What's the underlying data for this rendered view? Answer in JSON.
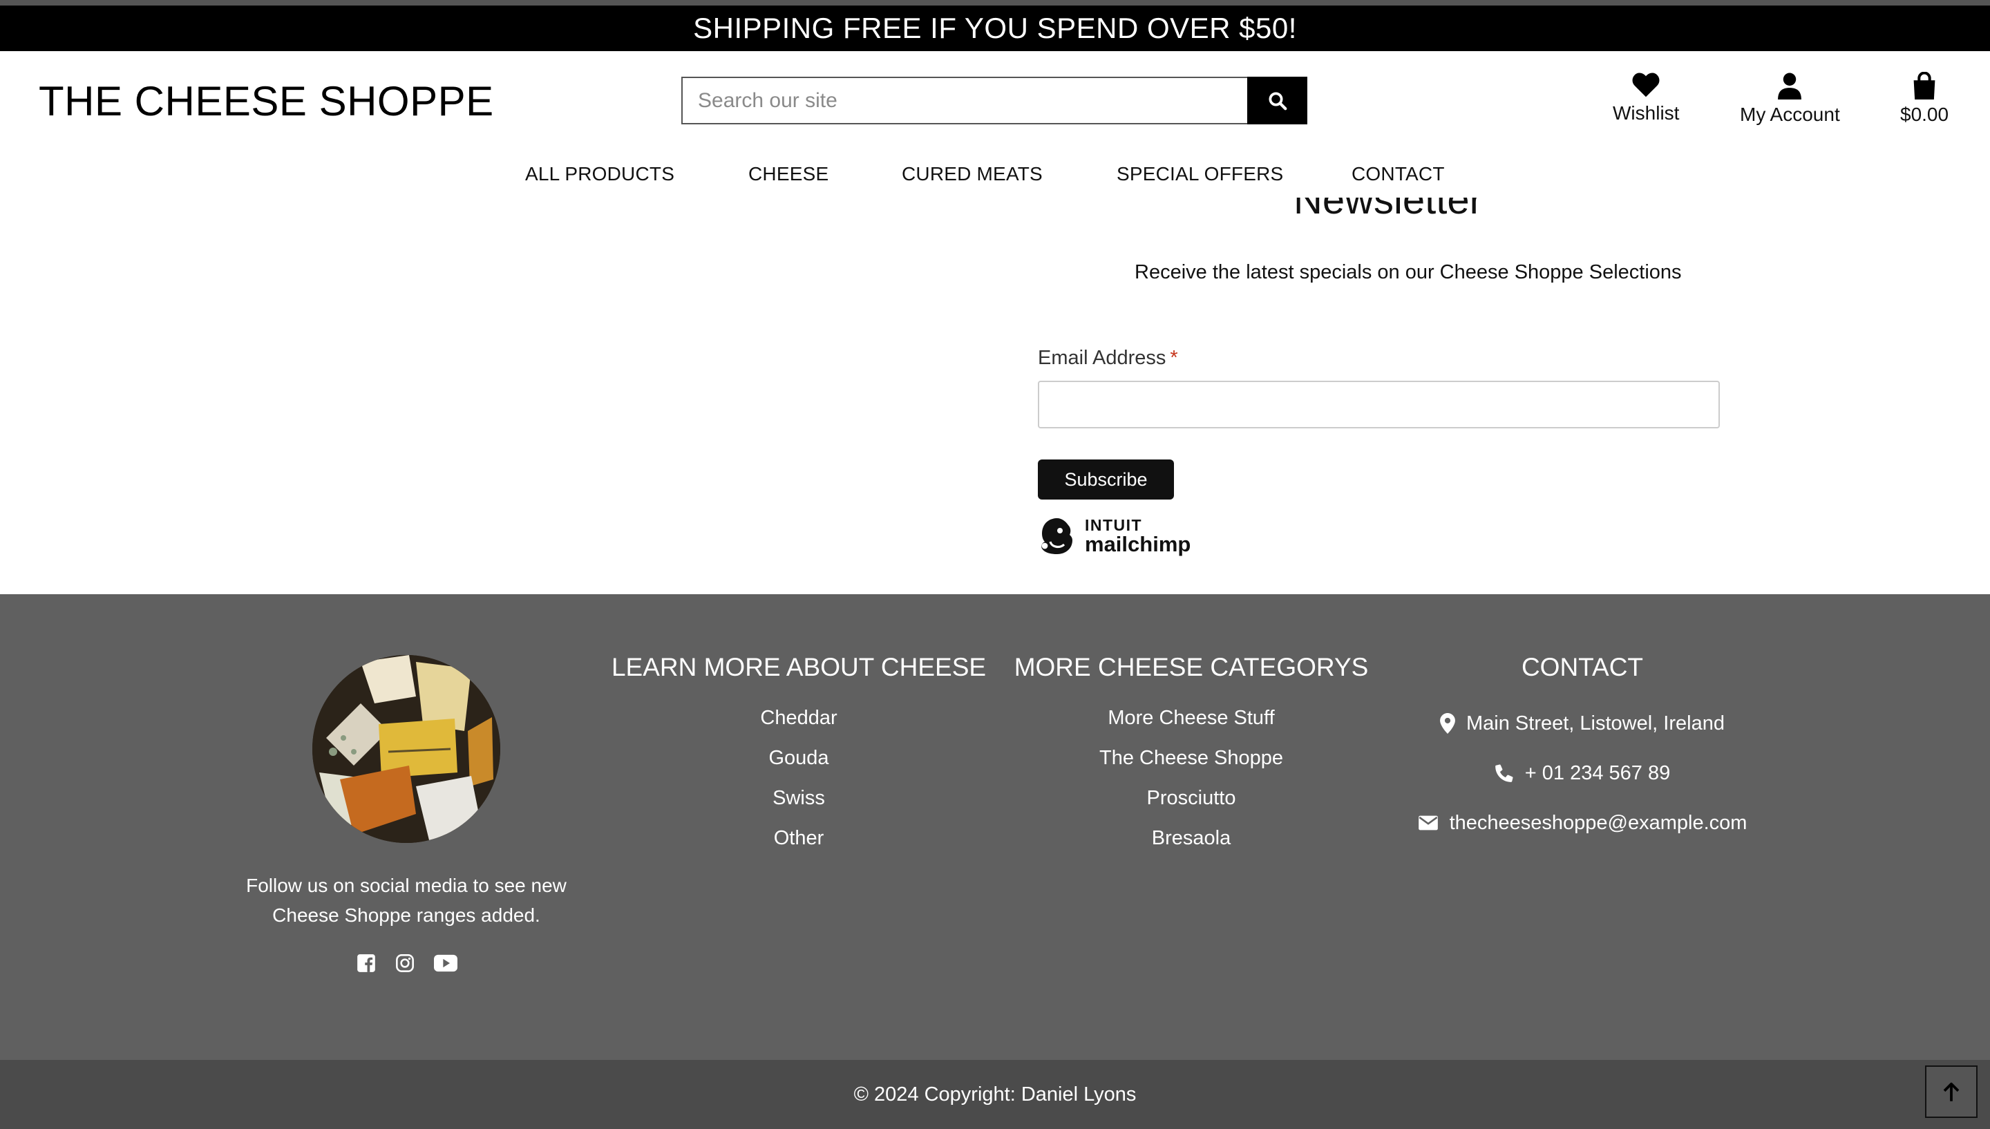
{
  "banner": {
    "text": "SHIPPING FREE IF YOU SPEND OVER $50!"
  },
  "header": {
    "logo": "THE CHEESE SHOPPE",
    "search": {
      "placeholder": "Search our site",
      "value": ""
    },
    "wishlist_label": "Wishlist",
    "account_label": "My Account",
    "cart_total": "$0.00"
  },
  "nav": {
    "items": [
      {
        "label": "ALL PRODUCTS"
      },
      {
        "label": "CHEESE"
      },
      {
        "label": "CURED MEATS"
      },
      {
        "label": "SPECIAL OFFERS"
      },
      {
        "label": "CONTACT"
      }
    ]
  },
  "newsletter": {
    "title": "Newsletter",
    "subtitle": "Receive the latest specials on our Cheese Shoppe Selections",
    "email_label": "Email Address",
    "required_mark": "*",
    "email_value": "",
    "subscribe_label": "Subscribe",
    "badge_line1": "INTUIT",
    "badge_line2": "mailchimp"
  },
  "footer": {
    "follow_text": "Follow us on social media to see new Cheese Shoppe ranges added.",
    "social_icons": [
      "facebook-icon",
      "instagram-icon",
      "youtube-icon"
    ],
    "learn": {
      "heading": "LEARN MORE ABOUT CHEESE",
      "links": [
        "Cheddar",
        "Gouda",
        "Swiss",
        "Other"
      ]
    },
    "categories": {
      "heading": "MORE CHEESE CATEGORYS",
      "links": [
        "More Cheese Stuff",
        "The Cheese Shoppe",
        "Prosciutto",
        "Bresaola"
      ]
    },
    "contact": {
      "heading": "CONTACT",
      "address": "Main Street, Listowel, Ireland",
      "phone": "+ 01 234 567 89",
      "email": "thecheeseshoppe@example.com"
    }
  },
  "copyright": "© 2024 Copyright: Daniel Lyons",
  "colors": {
    "banner_bg": "#000000",
    "footer_bg": "#606060",
    "copyright_bg": "#4b4b4b",
    "required": "#c6361d"
  }
}
